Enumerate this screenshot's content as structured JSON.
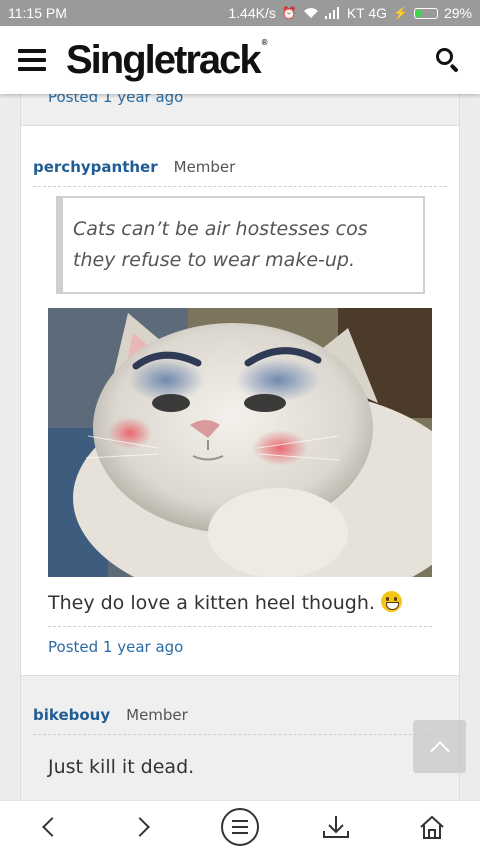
{
  "status_bar": {
    "time": "11:15 PM",
    "speed": "1.44K/s",
    "carrier": "KT 4G",
    "battery": "29%",
    "battery_level": 0.29,
    "battery_color": "#3fd84c"
  },
  "header": {
    "logo": "Singletrack",
    "menu_icon": "hamburger-icon",
    "search_icon": "search-icon"
  },
  "posts": [
    {
      "posted": "Posted 1 year ago"
    },
    {
      "author": "perchypanther",
      "role": "Member",
      "quote": "Cats can’t be air hostesses cos they refuse to wear make-up.",
      "image_icon": "cat-with-makeup-photo",
      "text": "They do love a kitten heel though.",
      "emoji_icon": "grinning-emoji-icon",
      "posted": "Posted 1 year ago"
    },
    {
      "author": "bikebouy",
      "role": "Member",
      "text": "Just kill it dead."
    }
  ],
  "colors": {
    "link": "#2d6ca2",
    "author": "#1f5d93",
    "status_bar": "#9a9a9a"
  },
  "nav_bar": {
    "icons": [
      "back-icon",
      "forward-icon",
      "menu-icon",
      "download-icon",
      "home-icon"
    ]
  }
}
